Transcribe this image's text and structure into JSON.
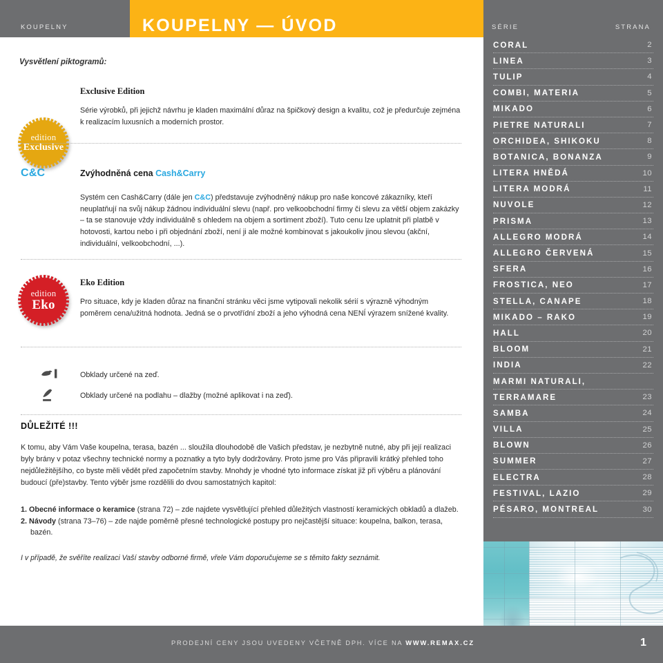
{
  "header": {
    "left_label": "KOUPELNY",
    "title": "KOUPELNY — ÚVOD",
    "serie_label": "SÉRIE",
    "strana_label": "STRANA",
    "accent_color": "#fcb315",
    "gray_color": "#6d6e70"
  },
  "content": {
    "lead_note": "Vysvětlení piktogramů:",
    "exclusive": {
      "badge_line1": "edition",
      "badge_line2": "Exclusive",
      "badge_color": "#e5a711",
      "title": "Exclusive Edition",
      "body": "Série výrobků, při jejichž návrhu je kladen maximální důraz na špičkový design a kvalitu, což je předurčuje zejména k realizacím luxusních a moderních prostor."
    },
    "cashcarry": {
      "mark": "C&C",
      "mark_color": "#2aa8e0",
      "title_plain": "Zvýhodněná cena ",
      "title_accent": "Cash&Carry",
      "body_part1": "Systém cen Cash&Carry (dále jen ",
      "body_accent": "C&C",
      "body_part2": ") představuje zvýhodněný nákup pro naše koncové zákazníky, kteří neuplatňují na svůj nákup žádnou individuální slevu (např. pro velkoobchodní firmy či slevu za větší objem zakázky – ta se stanovuje vždy individuálně s ohledem na objem a sortiment zboží). Tuto cenu lze uplatnit při platbě v hotovosti, kartou nebo i při objednání zboží, není ji ale možné kombinovat s jakoukoliv jinou slevou (akční, individuální, velkoobchodní, ...)."
    },
    "eko": {
      "badge_line1": "edition",
      "badge_line2": "Eko",
      "badge_color": "#d41f26",
      "title": "Eko Edition",
      "body": "Pro situace, kdy je kladen důraz na finanční stránku věci jsme vytipovali nekolik sérií s výrazně výhodným poměrem cena/užitná hodnota. Jedná se o prvotřídní zboží a jeho výhodná cena NENÍ výrazem snížené kvality."
    },
    "icons": [
      {
        "icon": "wall-tile-icon",
        "label": "Obklady určené na zeď."
      },
      {
        "icon": "floor-tile-icon",
        "label": "Obklady určené na podlahu – dlažby (možné aplikovat i na zeď)."
      }
    ],
    "important": {
      "title": "DŮLEŽITÉ !!!",
      "body": "K tomu, aby Vám Vaše koupelna, terasa, bazén ... sloužila dlouhodobě dle Vašich představ, je nezbytně nutné, aby při její realizaci byly brány v potaz všechny technické normy a poznatky a tyto byly dodržovány. Proto jsme pro Vás připravili krátký přehled toho nejdůležitějšího, co byste měli vědět před započetním stavby. Mnohdy je vhodné tyto informace získat již při výběru a plánování budoucí (pře)stavby. Tento výběr jsme rozdělili do dvou samostatných kapitol:",
      "items": [
        {
          "num": "1.",
          "bold": "Obecné informace o keramice",
          "rest": " (strana 72) – zde najdete vysvětlující přehled důležitých vlastností keramických obkladů a dlažeb."
        },
        {
          "num": "2.",
          "bold": "Návody",
          "rest": " (strana 73–76) – zde najde poměrně přesné technologické postupy pro nejčastější situace: koupelna, balkon, terasa, bazén."
        }
      ],
      "closing": "I v případě, že svěříte realizaci Vaší stavby odborné firmě, vřele Vám doporučujeme se s těmito fakty seznámit."
    }
  },
  "toc": {
    "rows": [
      {
        "name": "CORAL",
        "page": "2"
      },
      {
        "name": "LINEA",
        "page": "3"
      },
      {
        "name": "TULIP",
        "page": "4"
      },
      {
        "name": "COMBI, MATERIA",
        "page": "5"
      },
      {
        "name": "MIKADO",
        "page": "6"
      },
      {
        "name": "PIETRE NATURALI",
        "page": "7"
      },
      {
        "name": "ORCHIDEA, SHIKOKU",
        "page": "8"
      },
      {
        "name": "BOTANICA, BONANZA",
        "page": "9"
      },
      {
        "name": "LITERA HNĚDÁ",
        "page": "10"
      },
      {
        "name": "LITERA MODRÁ",
        "page": "11"
      },
      {
        "name": "NUVOLE",
        "page": "12"
      },
      {
        "name": "PRISMA",
        "page": "13"
      },
      {
        "name": "ALLEGRO MODRÁ",
        "page": "14"
      },
      {
        "name": "ALLEGRO ČERVENÁ",
        "page": "15"
      },
      {
        "name": "SFERA",
        "page": "16"
      },
      {
        "name": "FROSTICA, NEO",
        "page": "17"
      },
      {
        "name": "STELLA, CANAPE",
        "page": "18"
      },
      {
        "name": "MIKADO – RAKO",
        "page": "19"
      },
      {
        "name": "HALL",
        "page": "20"
      },
      {
        "name": "BLOOM",
        "page": "21"
      },
      {
        "name": "INDIA",
        "page": "22"
      },
      {
        "name": "MARMI NATURALI,",
        "page": ""
      },
      {
        "name": "TERRAMARE",
        "page": "23"
      },
      {
        "name": "SAMBA",
        "page": "24"
      },
      {
        "name": "VILLA",
        "page": "25"
      },
      {
        "name": "BLOWN",
        "page": "26"
      },
      {
        "name": "SUMMER",
        "page": "27"
      },
      {
        "name": "ELECTRA",
        "page": "28"
      },
      {
        "name": "FESTIVAL, LAZIO",
        "page": "29"
      },
      {
        "name": "PÉSARO, MONTREAL",
        "page": "30"
      }
    ]
  },
  "photo": {
    "alt": "bathroom-tile-photo"
  },
  "footer": {
    "text_plain": "PRODEJNÍ CENY JSOU UVEDENY VČETNĚ DPH. VÍCE NA ",
    "text_bold": "WWW.REMAX.CZ",
    "page_number": "1"
  }
}
